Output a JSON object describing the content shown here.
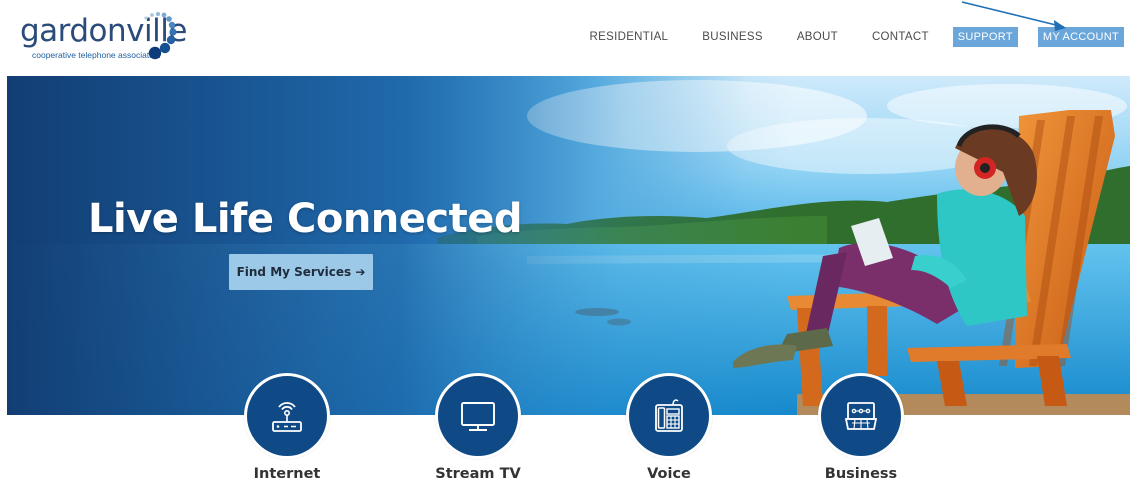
{
  "brand": {
    "name": "gardonville",
    "tagline": "cooperative telephone association"
  },
  "nav": {
    "links": [
      "RESIDENTIAL",
      "BUSINESS",
      "ABOUT",
      "CONTACT"
    ],
    "support_label": "SUPPORT",
    "account_label": "MY ACCOUNT"
  },
  "hero": {
    "title": "Live Life Connected",
    "cta_label": "Find My Services ➔"
  },
  "services": [
    {
      "label": "Internet",
      "icon": "router-icon"
    },
    {
      "label": "Stream TV",
      "icon": "monitor-icon"
    },
    {
      "label": "Voice",
      "icon": "phone-icon"
    },
    {
      "label": "Business",
      "icon": "business-icon"
    }
  ],
  "colors": {
    "brand_blue": "#0f4a86",
    "accent_button": "#6aa6d9",
    "cta_button": "#9cc9e7",
    "logo_text": "#2b4c7a"
  }
}
